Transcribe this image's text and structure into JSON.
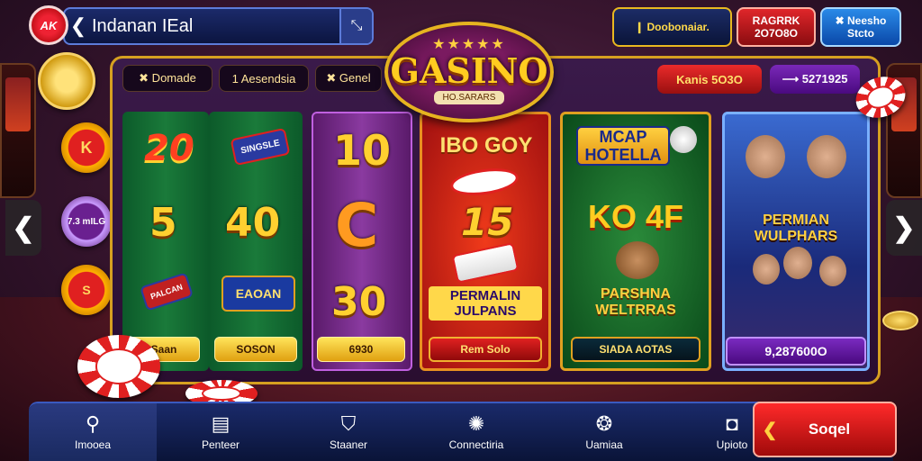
{
  "header": {
    "logo_text": "AK",
    "back_glyph": "❮",
    "title": "Indanan IEal",
    "title_button_glyph": "⤡",
    "btn_info": "❙ Doobonaiar.",
    "btn_red": "RAGRRK 2O7O8O",
    "btn_blue": "✖ Neesho Stcto"
  },
  "side_chips": {
    "top": "K",
    "middle": "7.3 mILG",
    "bottom": "S"
  },
  "filters": [
    "✖ Domade",
    "1 Aesendsia",
    "✖ Genel"
  ],
  "tags": {
    "red": "Kanis 5O3O",
    "purple": "⟶ 5271925"
  },
  "casino": {
    "stars": "★★★★★",
    "name": "GASINO",
    "sub": "HO.SARARS"
  },
  "columns": {
    "c1": {
      "num_top": "20",
      "num_mid": "5",
      "sticker": "PALCAN",
      "label": "Saan"
    },
    "c2": {
      "sticker_top": "SINGSLE",
      "num_mid": "40",
      "sticker_bottom": "EAOAN",
      "label": "SOSON"
    },
    "c3": {
      "num_top": "10",
      "num_mid": "C",
      "num_bottom": "30",
      "label": "6930"
    },
    "c4": {
      "title": "IBO GOY",
      "num": "15",
      "caption": "PERMALIN JULPANS",
      "label": "Rem Solo"
    },
    "c5": {
      "title": "MCAP HOTELLA",
      "big": "KO 4F",
      "caption": "PARSHNA WELTRRAS",
      "label": "SIADA AOTAS"
    },
    "c6": {
      "caption": "PERMIAN WULPHARS",
      "label": "9,287600O"
    }
  },
  "bottom_nav": [
    {
      "label": "Imooea",
      "icon": "⚲"
    },
    {
      "label": "Penteer",
      "icon": "▤"
    },
    {
      "label": "Staaner",
      "icon": "⛉"
    },
    {
      "label": "Connectiria",
      "icon": "✺"
    },
    {
      "label": "Uamiaa",
      "icon": "❂"
    },
    {
      "label": "Upioto",
      "icon": "◘"
    }
  ],
  "cta": {
    "chevron": "❮",
    "label": "Soqel"
  },
  "nav_arrows": {
    "left": "❮",
    "right": "❯"
  }
}
